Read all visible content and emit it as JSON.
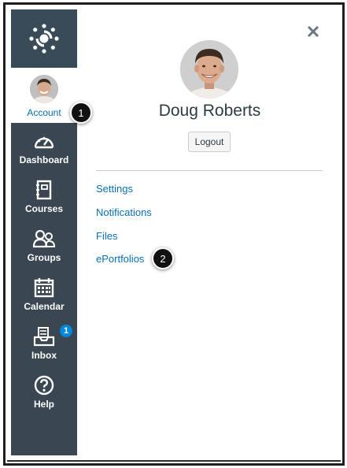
{
  "nav": {
    "logo_icon": "canvas-logo-icon",
    "account": {
      "label": "Account",
      "icon": "user-avatar"
    },
    "items": [
      {
        "label": "Dashboard",
        "icon": "dashboard-gauge-icon"
      },
      {
        "label": "Courses",
        "icon": "courses-book-icon"
      },
      {
        "label": "Groups",
        "icon": "groups-people-icon"
      },
      {
        "label": "Calendar",
        "icon": "calendar-icon"
      },
      {
        "label": "Inbox",
        "icon": "inbox-tray-icon",
        "badge": "1"
      },
      {
        "label": "Help",
        "icon": "help-question-icon"
      }
    ]
  },
  "tray": {
    "close_icon": "close-icon",
    "user_name": "Doug Roberts",
    "logout_label": "Logout",
    "links": [
      {
        "label": "Settings"
      },
      {
        "label": "Notifications"
      },
      {
        "label": "Files"
      },
      {
        "label": "ePortfolios"
      }
    ]
  },
  "callouts": [
    "1",
    "2"
  ],
  "colors": {
    "nav_bg": "#3a4652",
    "link": "#0770b6",
    "badge": "#0088dd",
    "text": "#2d3b45"
  }
}
